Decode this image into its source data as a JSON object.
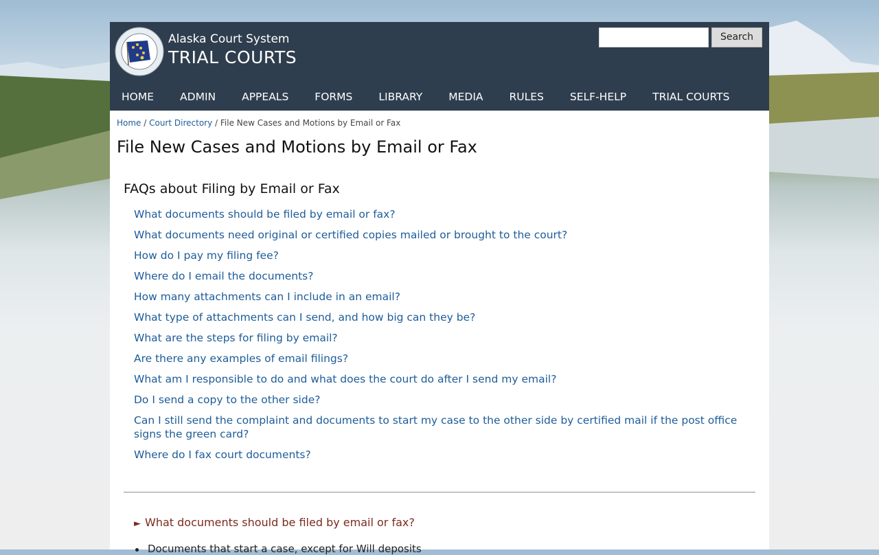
{
  "header": {
    "site_name": "Alaska Court System",
    "site_section": "TRIAL COURTS",
    "seal_icon": "alaska-court-seal"
  },
  "search": {
    "placeholder": "",
    "button_label": "Search"
  },
  "nav": {
    "items": [
      "HOME",
      "ADMIN",
      "APPEALS",
      "FORMS",
      "LIBRARY",
      "MEDIA",
      "RULES",
      "SELF-HELP",
      "TRIAL COURTS"
    ]
  },
  "breadcrumb": {
    "home": "Home",
    "sep1": " / ",
    "directory": "Court Directory",
    "sep2": " / ",
    "current": "File New Cases and Motions by Email or Fax"
  },
  "page_title": "File New Cases and Motions by Email or Fax",
  "faq": {
    "heading": "FAQs about Filing by Email or Fax",
    "questions": [
      "What documents should be filed by email or fax?",
      "What documents need original or certified copies mailed or brought to the court?",
      "How do I pay my filing fee?",
      "Where do I email the documents?",
      "How many attachments can I include in an email?",
      "What type of attachments can I send, and how big can they be?",
      "What are the steps for filing by email?",
      "Are there any examples of email filings?",
      "What am I responsible to do and what does the court do after I send my email?",
      "Do I send a copy to the other side?",
      "Can I still send the complaint and documents to start my case to the other side by certified mail if the post office signs the green card?",
      "Where do I fax court documents?"
    ]
  },
  "details": {
    "arrow": "►",
    "summary": "What documents should be filed by email or fax?",
    "first_bullet": "Documents that start a case, except for Will deposits"
  },
  "colors": {
    "header_bg": "#2f3e4e",
    "link": "#1d5c99",
    "summary": "#7a2a1e"
  }
}
